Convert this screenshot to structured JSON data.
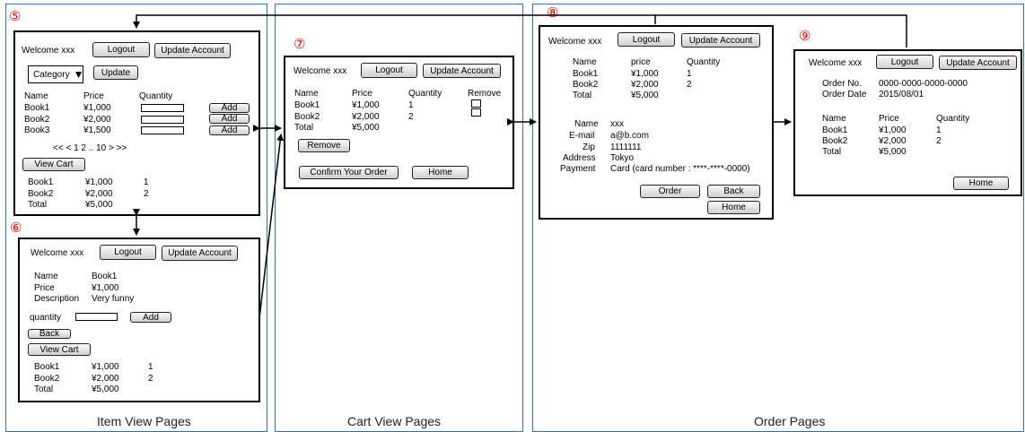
{
  "section_titles": {
    "item_view": "Item View Pages",
    "cart_view": "Cart View Pages",
    "order": "Order Pages"
  },
  "page_numbers": [
    "⑤",
    "⑥",
    "⑦",
    "⑧",
    "⑨"
  ],
  "common": {
    "welcome": "Welcome xxx",
    "logout": "Logout",
    "update_account": "Update Account"
  },
  "p5": {
    "category": "Category",
    "category_arrow": "▼",
    "update_button": "Update",
    "headers": [
      "Name",
      "Price",
      "Quantity"
    ],
    "rows": [
      {
        "name": "Book1",
        "price": "¥1,000",
        "add": "Add"
      },
      {
        "name": "Book2",
        "price": "¥2,000",
        "add": "Add"
      },
      {
        "name": "Book3",
        "price": "¥1,500",
        "add": "Add"
      }
    ],
    "pagination": "<< < 1 2 .. 10 > >>",
    "view_cart": "View Cart",
    "cart": [
      {
        "name": "Book1",
        "price": "¥1,000",
        "qty": "1"
      },
      {
        "name": "Book2",
        "price": "¥2,000",
        "qty": "2"
      }
    ],
    "total_label": "Total",
    "total_value": "¥5,000"
  },
  "p6": {
    "labels": [
      "Name",
      "Price",
      "Description"
    ],
    "values": [
      "Book1",
      "¥1,000",
      "Very funny"
    ],
    "quantity_label": "quantity",
    "add": "Add",
    "back": "Back",
    "view_cart": "View Cart",
    "cart": [
      {
        "name": "Book1",
        "price": "¥1,000",
        "qty": "1"
      },
      {
        "name": "Book2",
        "price": "¥2,000",
        "qty": "2"
      }
    ],
    "total_label": "Total",
    "total_value": "¥5,000"
  },
  "p7": {
    "headers": [
      "Name",
      "Price",
      "Quantity",
      "Remove"
    ],
    "rows": [
      {
        "name": "Book1",
        "price": "¥1,000",
        "qty": "1"
      },
      {
        "name": "Book2",
        "price": "¥2,000",
        "qty": "2"
      }
    ],
    "total_label": "Total",
    "total_value": "¥5,000",
    "remove_button": "Remove",
    "confirm_button": "Confirm Your Order",
    "home_button": "Home"
  },
  "p8": {
    "headers": [
      "Name",
      "price",
      "Quantity"
    ],
    "rows": [
      {
        "name": "Book1",
        "price": "¥1,000",
        "qty": "1"
      },
      {
        "name": "Book2",
        "price": "¥2,000",
        "qty": "2"
      }
    ],
    "total_label": "Total",
    "total_value": "¥5,000",
    "info_labels": [
      "Name",
      "E-mail",
      "Zip",
      "Address",
      "Payment"
    ],
    "info_values": [
      "xxx",
      "a@b.com",
      "1111111",
      "Tokyo",
      "Card (card number : ****-****-0000)"
    ],
    "order_button": "Order",
    "back_button": "Back",
    "home_button": "Home"
  },
  "p9": {
    "order_no_label": "Order No.",
    "order_no_value": "0000-0000-0000-0000",
    "order_date_label": "Order Date",
    "order_date_value": "2015/08/01",
    "headers": [
      "Name",
      "Price",
      "Quantity"
    ],
    "rows": [
      {
        "name": "Book1",
        "price": "¥1,000",
        "qty": "1"
      },
      {
        "name": "Book2",
        "price": "¥2,000",
        "qty": "2"
      }
    ],
    "total_label": "Total",
    "total_value": "¥5,000",
    "home_button": "Home"
  }
}
